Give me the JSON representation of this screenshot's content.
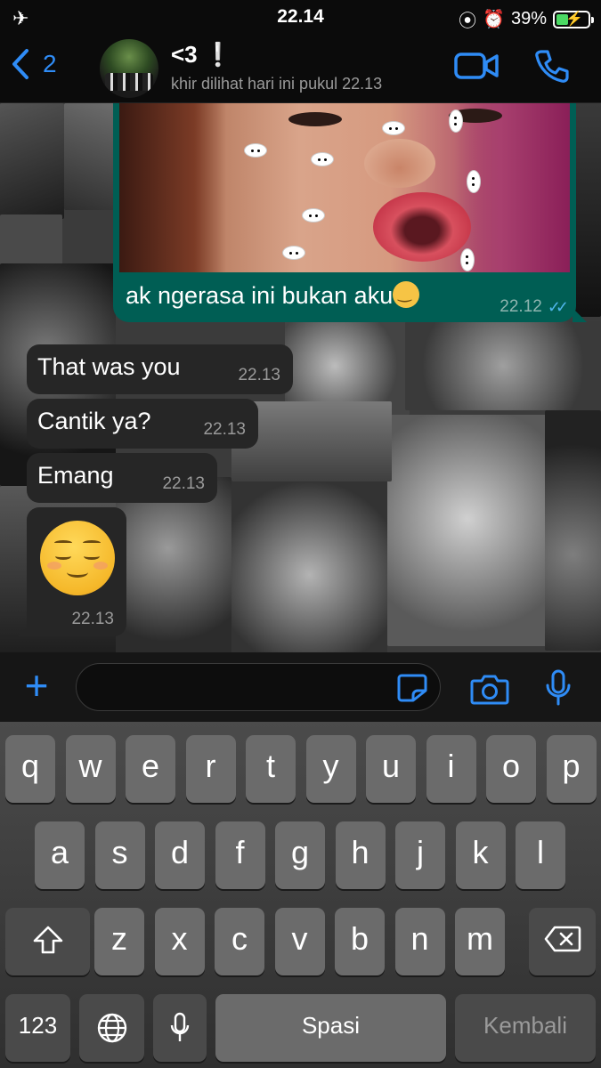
{
  "status_bar": {
    "time": "22.14",
    "battery": "39%",
    "airplane_icon": "airplane-icon"
  },
  "header": {
    "back_count": "2",
    "contact_name": "<3 ❕",
    "last_seen": "khir dilihat hari ini pukul 22.13"
  },
  "messages": [
    {
      "direction": "out",
      "type": "image",
      "caption": "ak ngerasa ini bukan aku",
      "time": "22.12",
      "status": "read"
    },
    {
      "direction": "in",
      "text": "That was you",
      "time": "22.13"
    },
    {
      "direction": "in",
      "text": "Cantik ya?",
      "time": "22.13"
    },
    {
      "direction": "in",
      "text": "Emang",
      "time": "22.13"
    },
    {
      "direction": "in",
      "type": "emoji",
      "emoji": "relieved-face-emoji",
      "time": "22.13"
    }
  ],
  "input": {
    "placeholder": ""
  },
  "keyboard": {
    "row1": [
      "q",
      "w",
      "e",
      "r",
      "t",
      "y",
      "u",
      "i",
      "o",
      "p"
    ],
    "row2": [
      "a",
      "s",
      "d",
      "f",
      "g",
      "h",
      "j",
      "k",
      "l"
    ],
    "row3": [
      "z",
      "x",
      "c",
      "v",
      "b",
      "n",
      "m"
    ],
    "numbers_label": "123",
    "space_label": "Spasi",
    "return_label": "Kembali"
  },
  "colors": {
    "accent": "#2f8cf6",
    "outgoing_bubble": "#005e54",
    "incoming_bubble": "#262626",
    "read_ticks": "#4fb6ec"
  }
}
